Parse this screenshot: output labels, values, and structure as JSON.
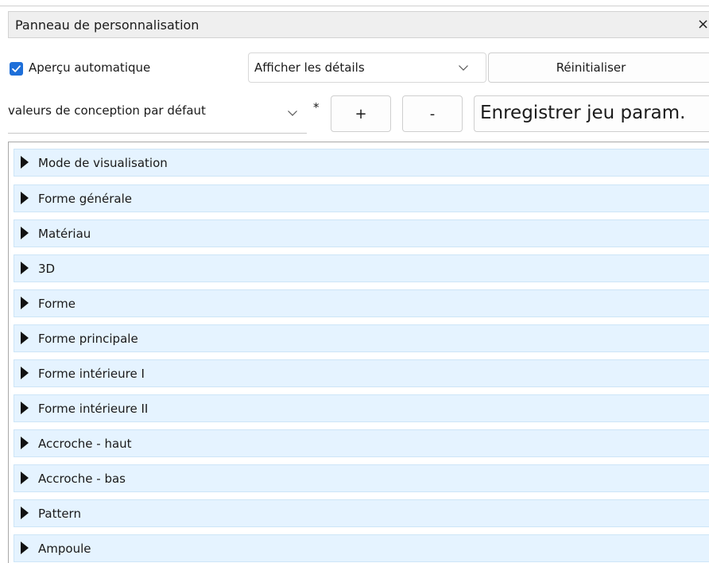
{
  "panel": {
    "title": "Panneau de personnalisation",
    "close_label": "×"
  },
  "toolbar": {
    "auto_preview_label": "Aperçu automatique",
    "auto_preview_checked": true,
    "details_select_value": "Afficher les détails",
    "reset_label": "Réinitialiser"
  },
  "presets": {
    "selected": "valeurs de conception par défaut",
    "modified_marker": "*",
    "add_label": "+",
    "remove_label": "-",
    "save_label": "Enregistrer jeu param."
  },
  "sections": [
    {
      "label": "Mode de visualisation"
    },
    {
      "label": "Forme générale"
    },
    {
      "label": "Matériau"
    },
    {
      "label": "3D"
    },
    {
      "label": "Forme"
    },
    {
      "label": "Forme principale"
    },
    {
      "label": "Forme intérieure I"
    },
    {
      "label": "Forme intérieure II"
    },
    {
      "label": "Accroche - haut"
    },
    {
      "label": "Accroche - bas"
    },
    {
      "label": "Pattern"
    },
    {
      "label": "Ampoule"
    }
  ],
  "colors": {
    "section_bg": "#e5f3ff",
    "checkbox_accent": "#1e6fd9"
  }
}
